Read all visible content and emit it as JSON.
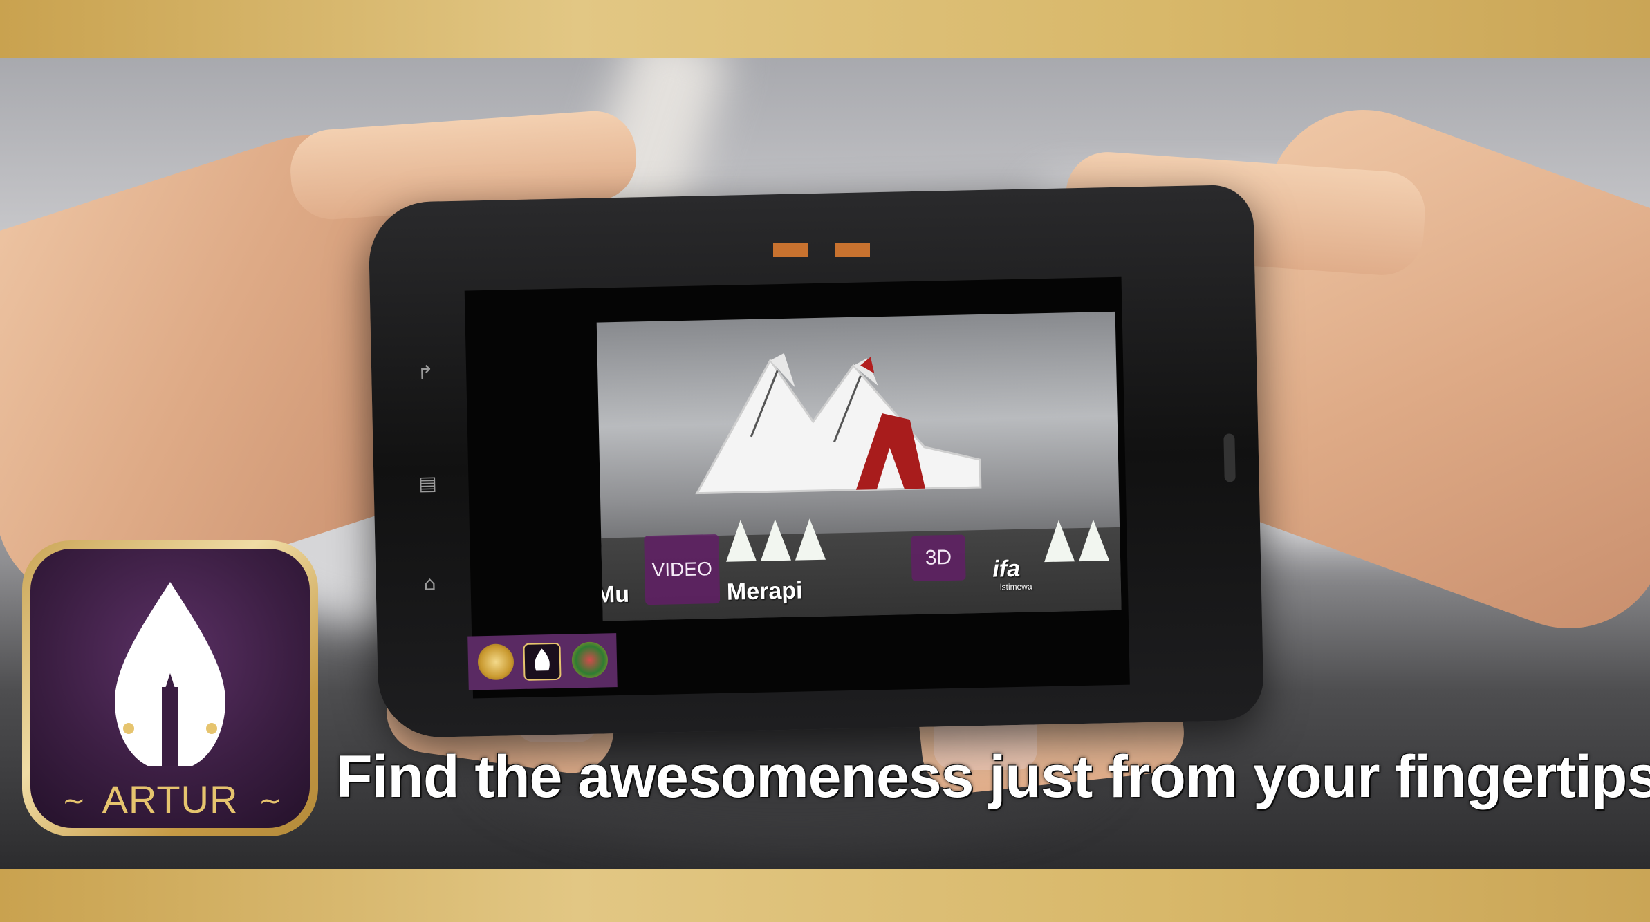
{
  "colors": {
    "gold": "#d8b86a",
    "purple": "#5a2a63",
    "button_purple": "#602064",
    "text_gold": "#e6c46e"
  },
  "logo": {
    "title": "ARTUR"
  },
  "tagline": "Find the awesomeness just from your fingertips",
  "ar_view": {
    "video_button": "VIDEO",
    "three_d_button": "3D",
    "museum_label_prefix": "Mu",
    "museum_label_suffix": "Merapi",
    "sign_text": "ifa",
    "sign_subtext": "istimewa"
  },
  "device_nav": {
    "back": "back-icon",
    "menu": "menu-icon",
    "home": "home-icon"
  },
  "toolbar": {
    "items": [
      "emblem-icon",
      "artur-icon",
      "crest-icon"
    ]
  }
}
